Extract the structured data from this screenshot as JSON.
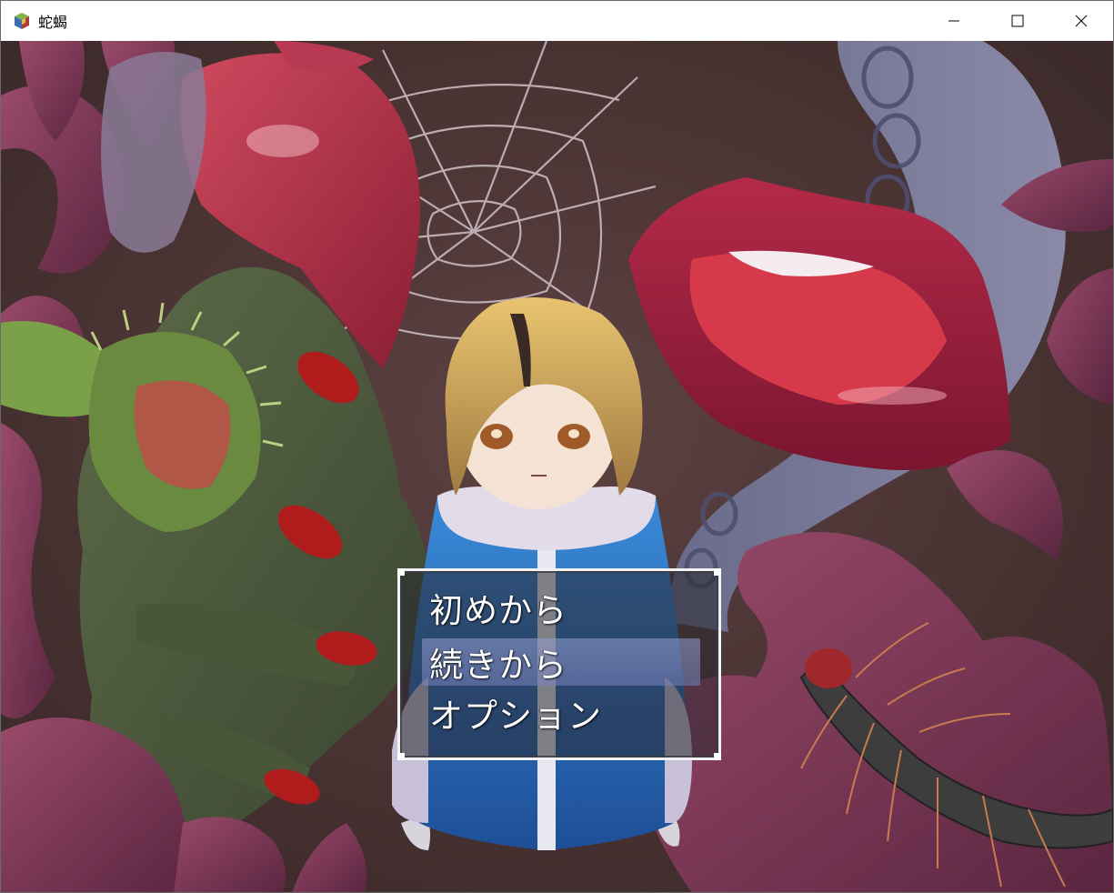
{
  "window": {
    "title": "蛇蝎",
    "app_icon": "game-cube-icon",
    "controls": [
      "minimize-icon",
      "maximize-icon",
      "close-icon"
    ]
  },
  "title_menu": {
    "items": [
      {
        "label": "初めから",
        "selected": false
      },
      {
        "label": "続きから",
        "selected": true
      },
      {
        "label": "オプション",
        "selected": false
      }
    ]
  },
  "colors": {
    "background": "#4a3434",
    "tentacle": "#7a3a55",
    "tongue": "#b0324a",
    "hand": "#4d5a3c",
    "nail": "#b01c1c",
    "lips": "#9a1e3a",
    "jacket": "#2a6bc4",
    "hair": "#d9b060"
  }
}
